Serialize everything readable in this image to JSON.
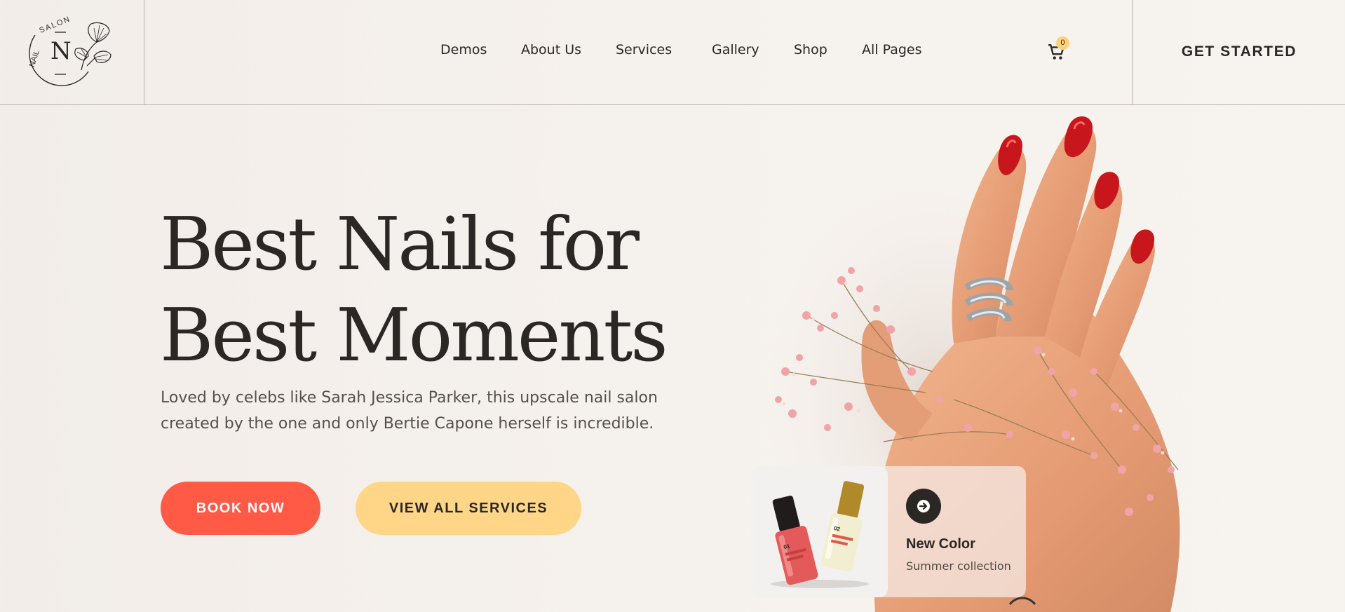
{
  "header": {
    "logo": {
      "text_top": "NAIL SALON",
      "monogram": "N"
    },
    "nav": [
      {
        "label": "Demos"
      },
      {
        "label": "About Us"
      },
      {
        "label": "Services"
      },
      {
        "label": "Gallery"
      },
      {
        "label": "Shop"
      },
      {
        "label": "All Pages"
      }
    ],
    "cart": {
      "icon": "cart-icon",
      "count": "0"
    },
    "cta_label": "GET STARTED"
  },
  "hero": {
    "title_line1": "Best Nails for",
    "title_line2": "Best Moments",
    "description": "Loved by celebs like Sarah Jessica Parker, this upscale nail salon created by the one and only Bertie Capone herself is incredible.",
    "book_label": "BOOK NOW",
    "services_label": "VIEW ALL SERVICES"
  },
  "product_card": {
    "title": "New Color",
    "subtitle": "Summer collection",
    "arrow_icon": "arrow-right-icon",
    "bottle_labels": [
      "01",
      "02"
    ]
  },
  "colors": {
    "accent_red": "#ff5a45",
    "accent_yellow": "#ffd688",
    "text_dark": "#2b2725",
    "nail_red": "#c8161d"
  }
}
